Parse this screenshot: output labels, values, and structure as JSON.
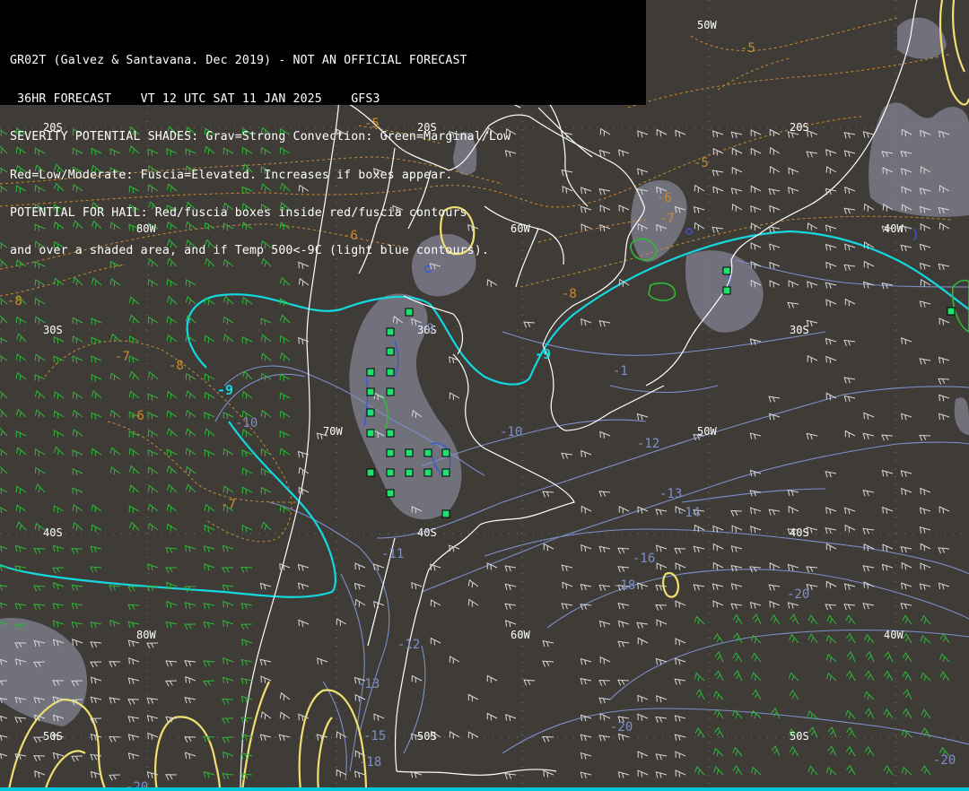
{
  "header": {
    "line1": "GR02T (Galvez & Santavana. Dec 2019) - NOT AN OFFICIAL FORECAST",
    "line2": " 36HR FORECAST    VT 12 UTC SAT 11 JAN 2025    GFS3",
    "line3": "SEVERITY POTENTIAL SHADES: Grav=Strong Convection: Green=Marginal/Low",
    "line4": "Red=Low/Moderate: Fuscia=Elevated. Increases if boxes appear.",
    "line5": "POTENTIAL FOR HAIL: Red/fuscia boxes inside red/fuscia contours",
    "line6": "and over a shaded area, and if Temp 500<-9C (light blue contours)."
  },
  "grid_labels": {
    "lat_20s": "20S",
    "lat_30s": "30S",
    "lat_40s": "40S",
    "lat_50s": "50S",
    "lon_80w": "80W",
    "lon_70w": "70W",
    "lon_60w": "60W",
    "lon_50w": "50W",
    "lon_40w": "40W"
  },
  "temp_labels": {
    "orange": [
      "-5",
      "-5",
      "-5",
      "-6",
      "-6",
      "-7",
      "-8",
      "-8",
      "-8",
      "-7",
      "-6",
      "-7"
    ],
    "cyan": [
      "-9",
      "-9"
    ],
    "blue": [
      "-10",
      "-10",
      "-11",
      "-12",
      "-13",
      "-14",
      "-16",
      "-18",
      "-20",
      "-20",
      "-12",
      "-13",
      "-15",
      "-18",
      "-20",
      "-1",
      "-9",
      "-20"
    ]
  },
  "colors": {
    "background": "#3f3c38",
    "coast": "#ffffff",
    "grid": "#8a8a8a",
    "orange_contour": "#c88a30",
    "cyan_contour": "#12d8e0",
    "blue_contour": "#7d8fc8",
    "yellow_contour": "#f0e070",
    "green_box": "#20e070",
    "wind_green": "#2fb83a",
    "wind_white": "#d8d8d8",
    "gray_shade": "#7a7a88"
  }
}
